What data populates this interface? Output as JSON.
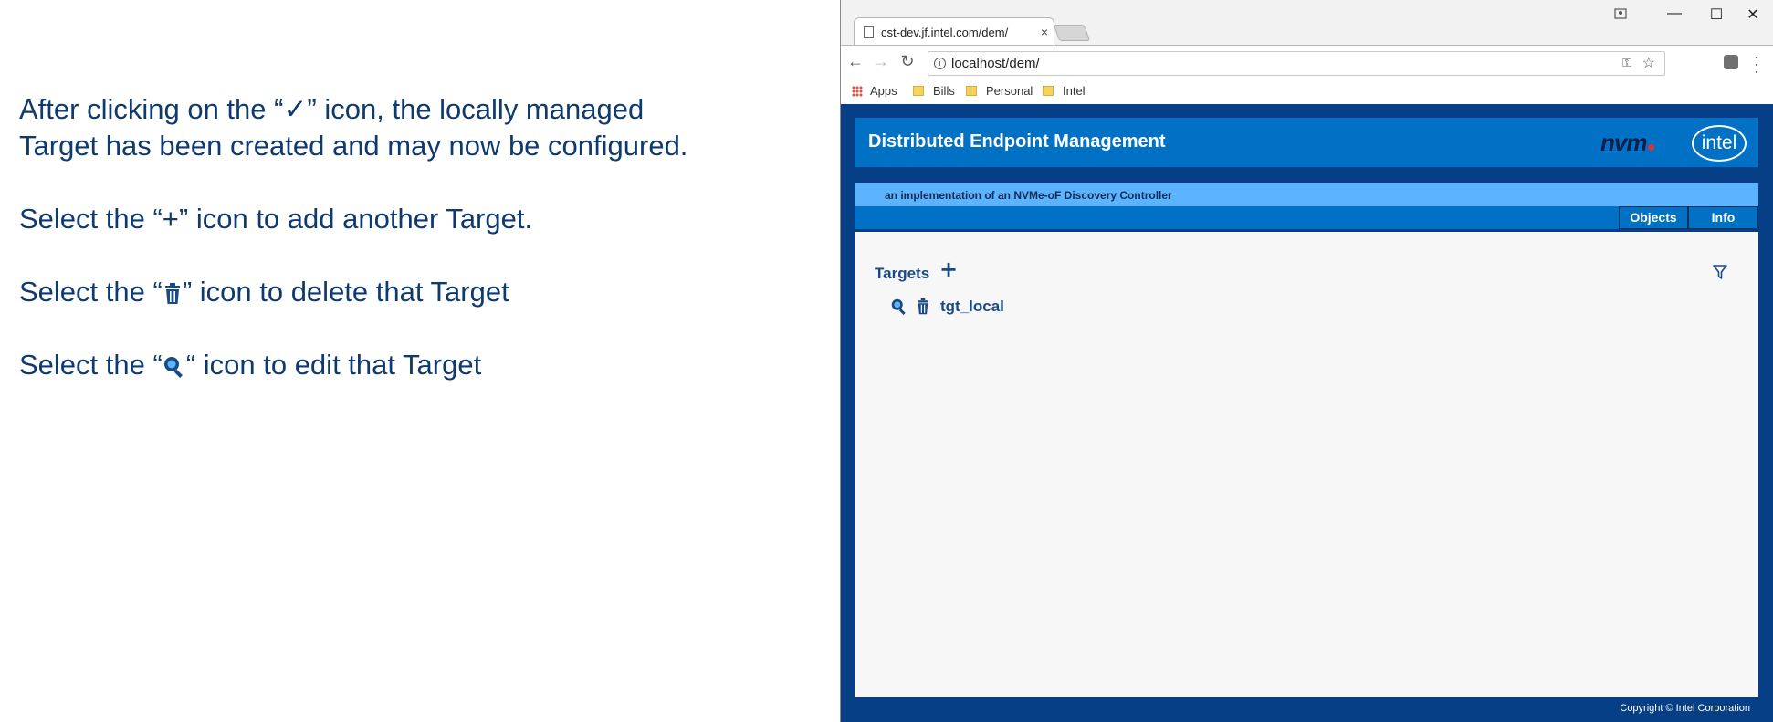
{
  "instructions": {
    "p1": "After clicking on the “✓” icon, the locally managed Target has been created and may now be configured.",
    "p2": "Select the “+” icon to add another Target.",
    "p3_before": "Select the “",
    "p3_after": "” icon to delete that Target",
    "p4_before": "Select the “",
    "p4_after": "“ icon to edit that Target",
    "text_color": "#0f3a6e"
  },
  "browser": {
    "tab_title": "cst-dev.jf.intel.com/dem/",
    "tab_close": "×",
    "address": "localhost/dem/",
    "window_controls": {
      "minimize": "—",
      "maximize": "☐",
      "close": "✕"
    },
    "nav": {
      "back": "←",
      "forward": "→",
      "reload": "↻"
    },
    "bookmarks": [
      {
        "label": "Apps",
        "icon": "apps-grid-icon"
      },
      {
        "label": "Bills",
        "icon": "folder-icon"
      },
      {
        "label": "Personal",
        "icon": "folder-icon"
      },
      {
        "label": "Intel",
        "icon": "folder-icon"
      }
    ]
  },
  "app": {
    "title": "Distributed Endpoint Management",
    "nvm_logo": "nvm",
    "intel_logo": "intel",
    "tagline": "an implementation of an NVMe-oF Discovery Controller",
    "nav": {
      "objects": "Objects",
      "info": "Info"
    },
    "section_title": "Targets",
    "add_symbol": "+",
    "targets": [
      {
        "name": "tgt_local"
      }
    ],
    "copyright": "Copyright © Intel Corporation",
    "colors": {
      "frame": "#063f86",
      "header": "#0071c5",
      "tagline_bar": "#5cb4ff",
      "content_bg": "#f7f7f7",
      "link": "#1a4a86"
    }
  }
}
